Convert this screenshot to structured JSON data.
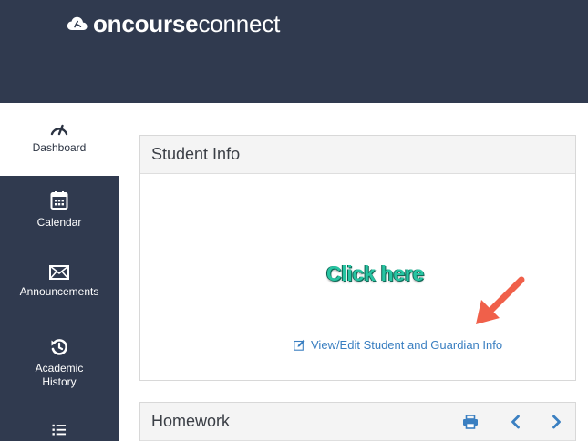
{
  "brand": {
    "name_bold": "oncourse",
    "name_light": "connect"
  },
  "sidebar": {
    "items": [
      {
        "label": "Dashboard",
        "icon": "gauge-icon",
        "active": true
      },
      {
        "label": "Calendar",
        "icon": "calendar-icon",
        "active": false
      },
      {
        "label": "Announcements",
        "icon": "envelope-icon",
        "active": false
      },
      {
        "label": "Academic History",
        "icon": "history-icon",
        "active": false
      },
      {
        "label": "",
        "icon": "list-icon",
        "active": false
      }
    ]
  },
  "student_info": {
    "title": "Student Info",
    "annotation": "Click here",
    "edit_link": "View/Edit Student and Guardian Info"
  },
  "homework": {
    "title": "Homework",
    "actions": [
      "print-icon",
      "chevron-left-icon",
      "chevron-right-icon"
    ]
  },
  "colors": {
    "header_bg": "#303a4f",
    "link": "#3a7fc1",
    "annotation": "#27c4a2",
    "arrow": "#f0604a"
  }
}
